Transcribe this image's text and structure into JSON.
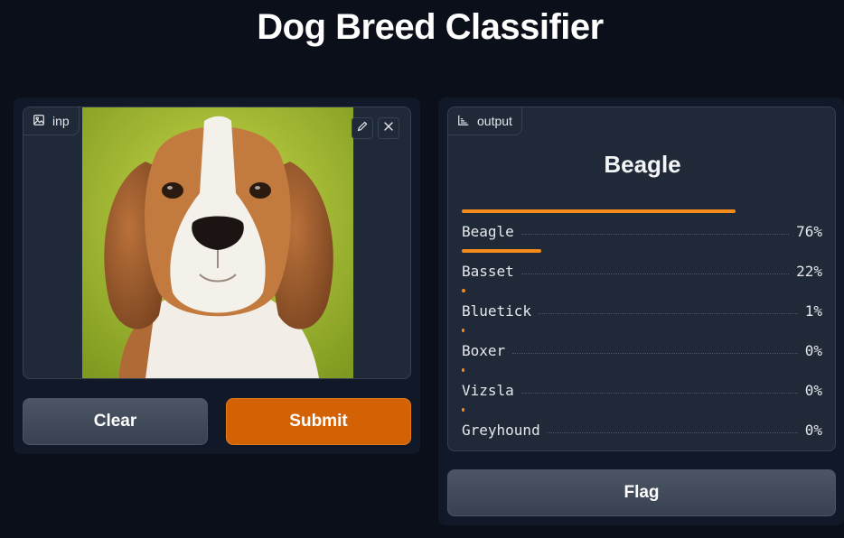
{
  "title": "Dog Breed Classifier",
  "input": {
    "label": "inp",
    "icon": "image-icon",
    "edit_icon": "pencil-icon",
    "close_icon": "close-icon"
  },
  "buttons": {
    "clear": "Clear",
    "submit": "Submit",
    "flag": "Flag"
  },
  "output": {
    "label": "output",
    "icon": "bar-chart-icon",
    "top_label": "Beagle",
    "confidences": [
      {
        "label": "Beagle",
        "pct": "76%",
        "value": 0.76
      },
      {
        "label": "Basset",
        "pct": "22%",
        "value": 0.22
      },
      {
        "label": "Bluetick",
        "pct": "1%",
        "value": 0.01
      },
      {
        "label": "Boxer",
        "pct": "0%",
        "value": 0.0
      },
      {
        "label": "Vizsla",
        "pct": "0%",
        "value": 0.0
      },
      {
        "label": "Greyhound",
        "pct": "0%",
        "value": 0.0
      }
    ]
  },
  "colors": {
    "accent": "#d36205",
    "bar": "#f48a1a",
    "background": "#0b0f19",
    "panel": "#111827",
    "block": "#1f2937"
  }
}
